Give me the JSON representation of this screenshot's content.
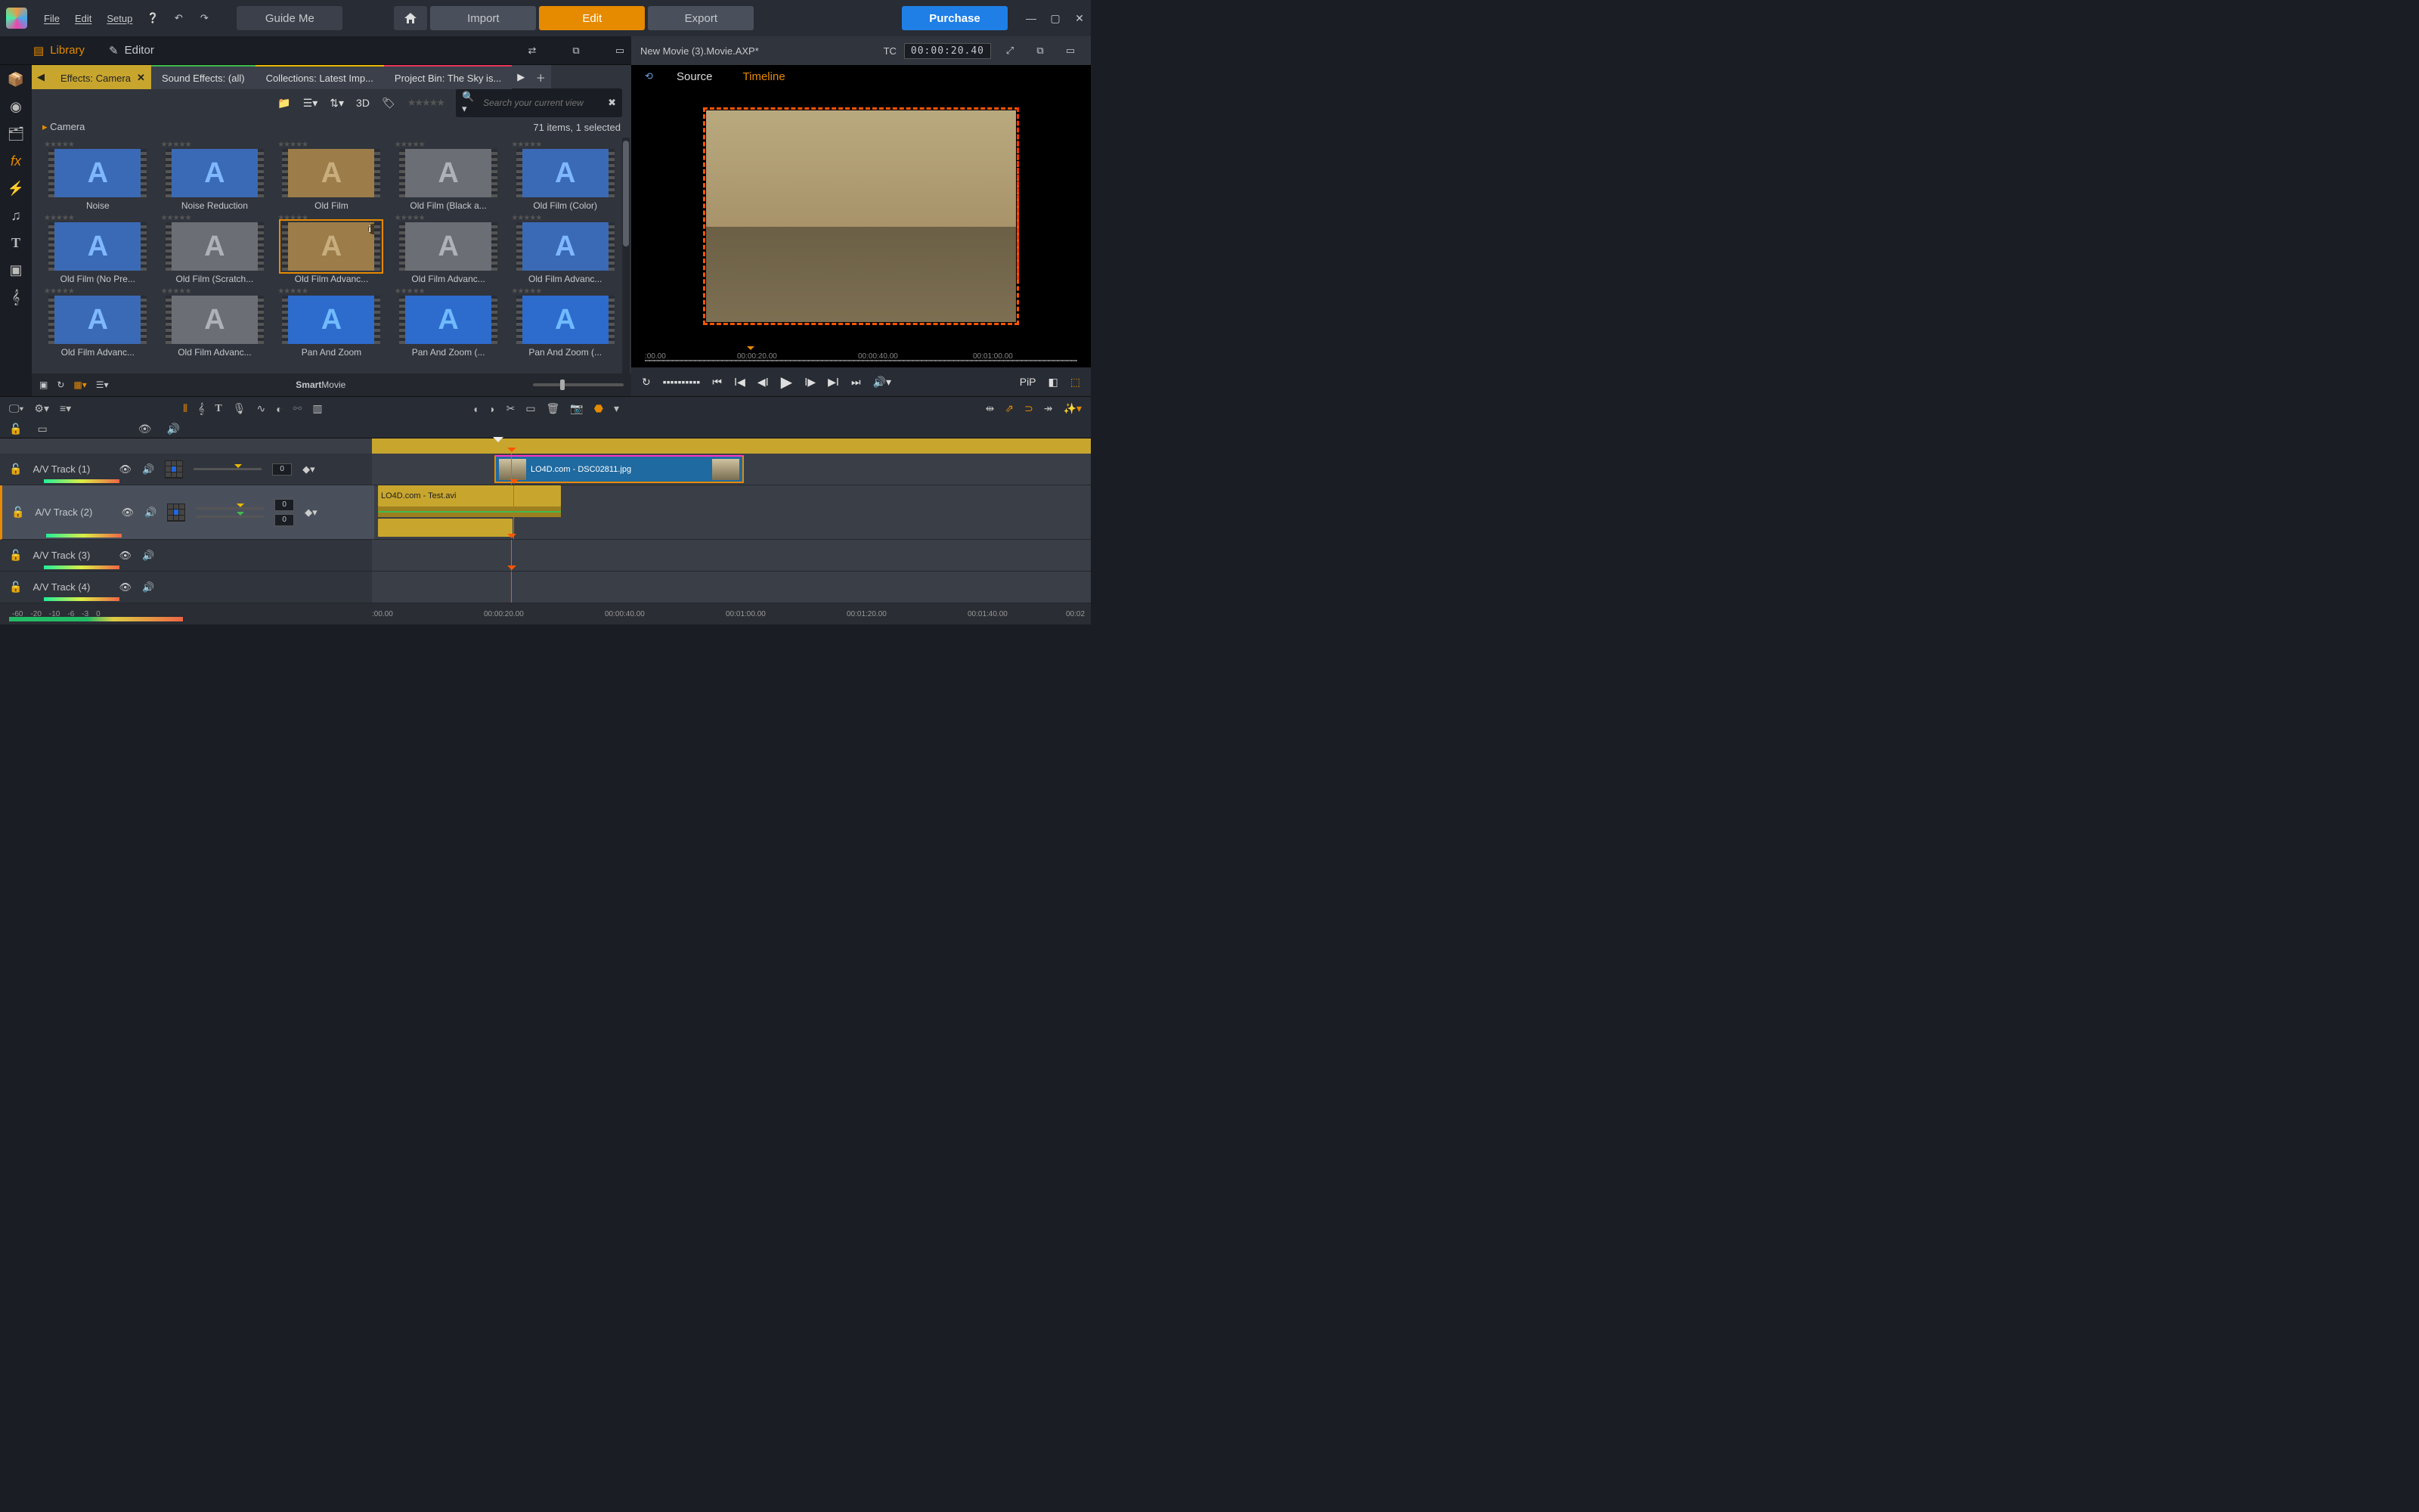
{
  "menu": {
    "file": "File",
    "edit": "Edit",
    "setup": "Setup",
    "guide": "Guide Me",
    "import": "Import",
    "editBtn": "Edit",
    "export": "Export",
    "purchase": "Purchase"
  },
  "subheader": {
    "library": "Library",
    "editor": "Editor",
    "project": "New Movie (3).Movie.AXP*",
    "tc_label": "TC",
    "tc": "00:00:20.40"
  },
  "preview": {
    "source": "Source",
    "timeline": "Timeline",
    "ruler": [
      ":00.00",
      "00:00:20.00",
      "00:00:40.00",
      "00:01:00.00"
    ],
    "pip": "PiP"
  },
  "library": {
    "tabs": [
      "Effects: Camera",
      "Sound Effects: (all)",
      "Collections: Latest Imp...",
      "Project Bin: The Sky is..."
    ],
    "threeD": "3D",
    "search_ph": "Search your current view",
    "section": "Camera",
    "status": "71 items, 1 selected",
    "footer": "SmartMovie",
    "items": [
      {
        "label": "Noise",
        "v": "blue"
      },
      {
        "label": "Noise Reduction",
        "v": "blue"
      },
      {
        "label": "Old Film",
        "v": "brown"
      },
      {
        "label": "Old Film (Black a...",
        "v": "grey"
      },
      {
        "label": "Old Film (Color)",
        "v": "blue"
      },
      {
        "label": "Old Film (No Pre...",
        "v": "blue"
      },
      {
        "label": "Old Film (Scratch...",
        "v": "grey"
      },
      {
        "label": "Old Film Advanc...",
        "v": "brown",
        "sel": true
      },
      {
        "label": "Old Film Advanc...",
        "v": "grey"
      },
      {
        "label": "Old Film Advanc...",
        "v": "blue"
      },
      {
        "label": "Old Film Advanc...",
        "v": "blue"
      },
      {
        "label": "Old Film Advanc...",
        "v": "grey"
      },
      {
        "label": "Pan And Zoom",
        "v": "blur"
      },
      {
        "label": "Pan And Zoom (...",
        "v": "blur"
      },
      {
        "label": "Pan And Zoom (...",
        "v": "blur"
      }
    ]
  },
  "timeline": {
    "tracks": [
      {
        "name": "A/V Track (1)",
        "v0": "0"
      },
      {
        "name": "A/V Track (2)",
        "v0": "0",
        "v1": "0",
        "sel": true,
        "tall": true
      },
      {
        "name": "A/V Track (3)"
      },
      {
        "name": "A/V Track (4)"
      }
    ],
    "clip_video": "LO4D.com - DSC02811.jpg",
    "clip_audio": "LO4D.com - Test.avi",
    "db": [
      "-60",
      "-20",
      "-10",
      "-6",
      "-3",
      "0"
    ],
    "ruler": [
      ":00.00",
      "00:00:20.00",
      "00:00:40.00",
      "00:01:00.00",
      "00:01:20.00",
      "00:01:40.00",
      "00:02"
    ]
  }
}
